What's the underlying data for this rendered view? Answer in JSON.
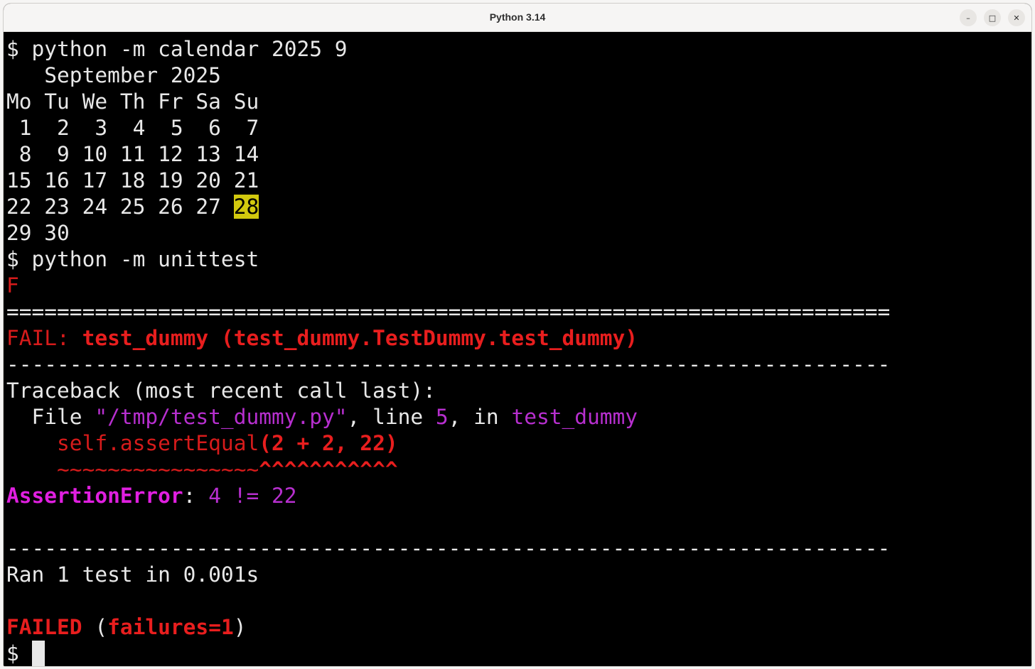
{
  "window": {
    "title": "Python 3.14",
    "controls": {
      "minimize": "–",
      "maximize": "□",
      "close": "✕"
    }
  },
  "colors": {
    "terminal_bg": "#000000",
    "text": "#e8e8e8",
    "error_red": "#d61b1b",
    "magenta": "#e01fe0",
    "purple": "#b72fcf",
    "highlight": "#d2c90e"
  },
  "terminal": {
    "cmd1": "$ python -m calendar 2025 9",
    "cal_title": "   September 2025",
    "cal_header": "Mo Tu We Th Fr Sa Su",
    "cal_week1": " 1  2  3  4  5  6  7",
    "cal_week2": " 8  9 10 11 12 13 14",
    "cal_week3": "15 16 17 18 19 20 21",
    "cal_week4_pre": "22 23 24 25 26 27 ",
    "cal_today": "28",
    "cal_week5": "29 30",
    "cmd2": "$ python -m unittest",
    "progress": "F",
    "sep_eq": "======================================================================",
    "fail_prefix": "FAIL: ",
    "fail_name": "test_dummy (test_dummy.TestDummy.test_dummy)",
    "sep_dash": "----------------------------------------------------------------------",
    "traceback": "Traceback (most recent call last):",
    "file_pre": "  File ",
    "file_path": "\"/tmp/test_dummy.py\"",
    "file_mid1": ", line ",
    "file_line": "5",
    "file_mid2": ", in ",
    "file_func": "test_dummy",
    "code_indent": "    ",
    "code_call": "self.assertEqual",
    "code_args": "(2 + 2, 22)",
    "marker_indent": "    ",
    "marker_tilde": "~~~~~~~~~~~~~~~~",
    "marker_caret": "^^^^^^^^^^^",
    "exc_type": "AssertionError",
    "exc_colon": ": ",
    "exc_msg": "4 != 22",
    "ran": "Ran 1 test in 0.001s",
    "failed_word": "FAILED",
    "failed_open": " (",
    "failed_detail": "failures=1",
    "failed_close": ")",
    "prompt": "$ "
  }
}
